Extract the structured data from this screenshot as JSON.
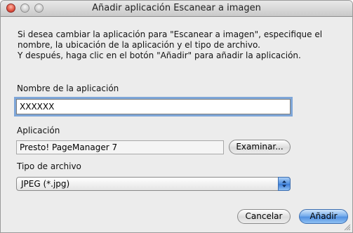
{
  "window": {
    "title": "Añadir aplicación Escanear a imagen",
    "controls": [
      "close-icon",
      "minimize-icon",
      "zoom-icon"
    ]
  },
  "instructions": {
    "line1": "Si desea cambiar la aplicación para \"Escanear a imagen\", especifique el",
    "line2": "nombre, la ubicación de la aplicación y el tipo de archivo.",
    "line3": "Y después, haga clic en el botón \"Añadir\" para añadir la aplicación."
  },
  "app_name": {
    "label": "Nombre de la aplicación",
    "value": "XXXXXX"
  },
  "application": {
    "label": "Aplicación",
    "value": "Presto! PageManager 7",
    "browse_label": "Examinar..."
  },
  "file_type": {
    "label": "Tipo de archivo",
    "selected": "JPEG (*.jpg)"
  },
  "buttons": {
    "cancel_label": "Cancelar",
    "add_label": "Añadir"
  },
  "colors": {
    "accent": "#4f8fe0",
    "focus_ring": "#7ea6d8",
    "window_bg": "#ececec"
  }
}
